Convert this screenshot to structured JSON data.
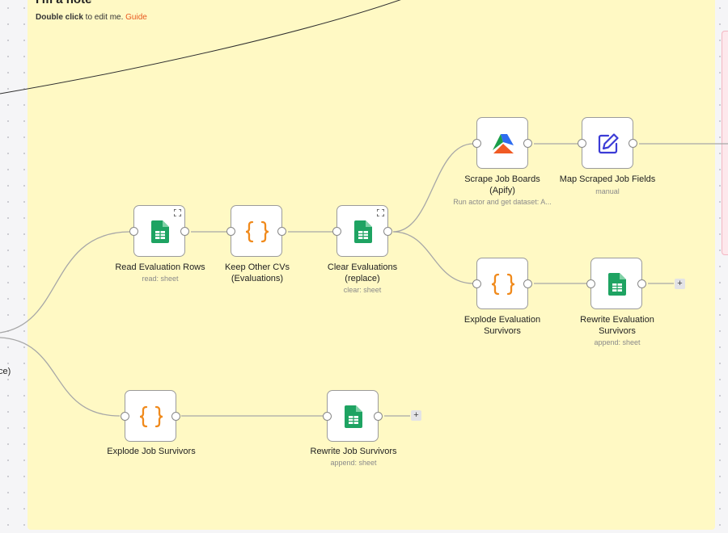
{
  "note": {
    "title": "I'm a note",
    "body_bold": "Double click",
    "body_text": " to edit me. ",
    "link": "Guide"
  },
  "edge_fragment": "ce)",
  "nodes": {
    "read_eval": {
      "label": "Read Evaluation Rows",
      "sub": "read: sheet",
      "icon": "google-sheets-icon"
    },
    "keep_cvs": {
      "label": "Keep Other CVs\n(Evaluations)",
      "icon": "code-braces-icon"
    },
    "clear_eval": {
      "label": "Clear Evaluations\n(replace)",
      "sub": "clear: sheet",
      "icon": "google-sheets-icon"
    },
    "scrape": {
      "label": "Scrape Job Boards\n(Apify)",
      "sub": "Run actor and get dataset: A...",
      "icon": "apify-icon"
    },
    "map_fields": {
      "label": "Map Scraped Job Fields",
      "sub": "manual",
      "icon": "pencil-edit-icon"
    },
    "explode_eval": {
      "label": "Explode Evaluation\nSurvivors",
      "icon": "code-braces-icon"
    },
    "rewrite_eval": {
      "label": "Rewrite Evaluation\nSurvivors",
      "sub": "append: sheet",
      "icon": "google-sheets-icon"
    },
    "explode_job": {
      "label": "Explode Job Survivors",
      "icon": "code-braces-icon"
    },
    "rewrite_job": {
      "label": "Rewrite Job Survivors",
      "sub": "append: sheet",
      "icon": "google-sheets-icon"
    }
  },
  "plus_label": "+",
  "colors": {
    "sticky": "#fff9c4",
    "sheets_green": "#1ea362",
    "braces_orange": "#f08a1c",
    "edit_blue": "#3b3bd6",
    "link_orange": "#e8591f"
  }
}
